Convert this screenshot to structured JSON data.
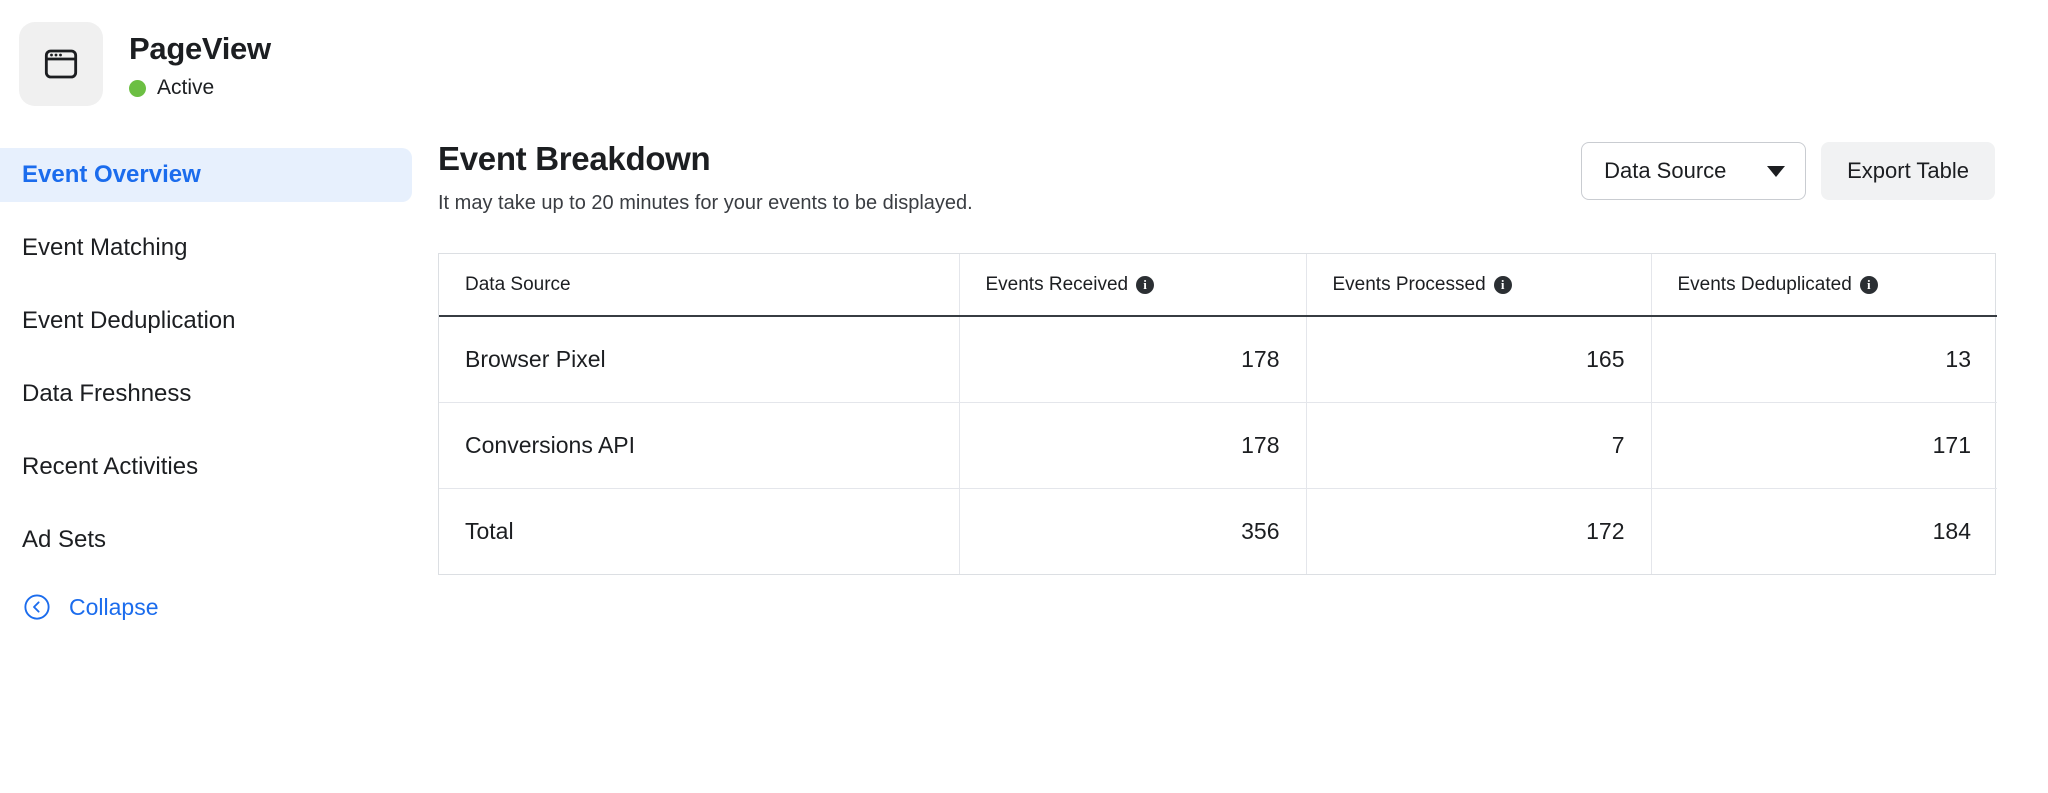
{
  "header": {
    "icon": "browser-window-icon",
    "title": "PageView",
    "status_label": "Active",
    "status_color": "#6cbf43"
  },
  "sidebar": {
    "items": [
      {
        "label": "Event Overview",
        "active": true
      },
      {
        "label": "Event Matching",
        "active": false
      },
      {
        "label": "Event Deduplication",
        "active": false
      },
      {
        "label": "Data Freshness",
        "active": false
      },
      {
        "label": "Recent Activities",
        "active": false
      },
      {
        "label": "Ad Sets",
        "active": false
      }
    ],
    "collapse": {
      "label": "Collapse",
      "icon": "chevron-left-circle-icon"
    },
    "active_color": "#1b6ced",
    "active_bg": "#e7f0fd"
  },
  "main": {
    "title": "Event Breakdown",
    "subtitle": "It may take up to 20 minutes for your events to be displayed.",
    "actions": {
      "data_source_label": "Data Source",
      "export_label": "Export Table"
    },
    "table": {
      "columns": [
        {
          "label": "Data Source",
          "info": false
        },
        {
          "label": "Events Received",
          "info": true
        },
        {
          "label": "Events Processed",
          "info": true
        },
        {
          "label": "Events Deduplicated",
          "info": true
        }
      ],
      "rows": [
        {
          "source": "Browser Pixel",
          "received": "178",
          "processed": "165",
          "deduplicated": "13"
        },
        {
          "source": "Conversions API",
          "received": "178",
          "processed": "7",
          "deduplicated": "171"
        },
        {
          "source": "Total",
          "received": "356",
          "processed": "172",
          "deduplicated": "184"
        }
      ]
    }
  }
}
